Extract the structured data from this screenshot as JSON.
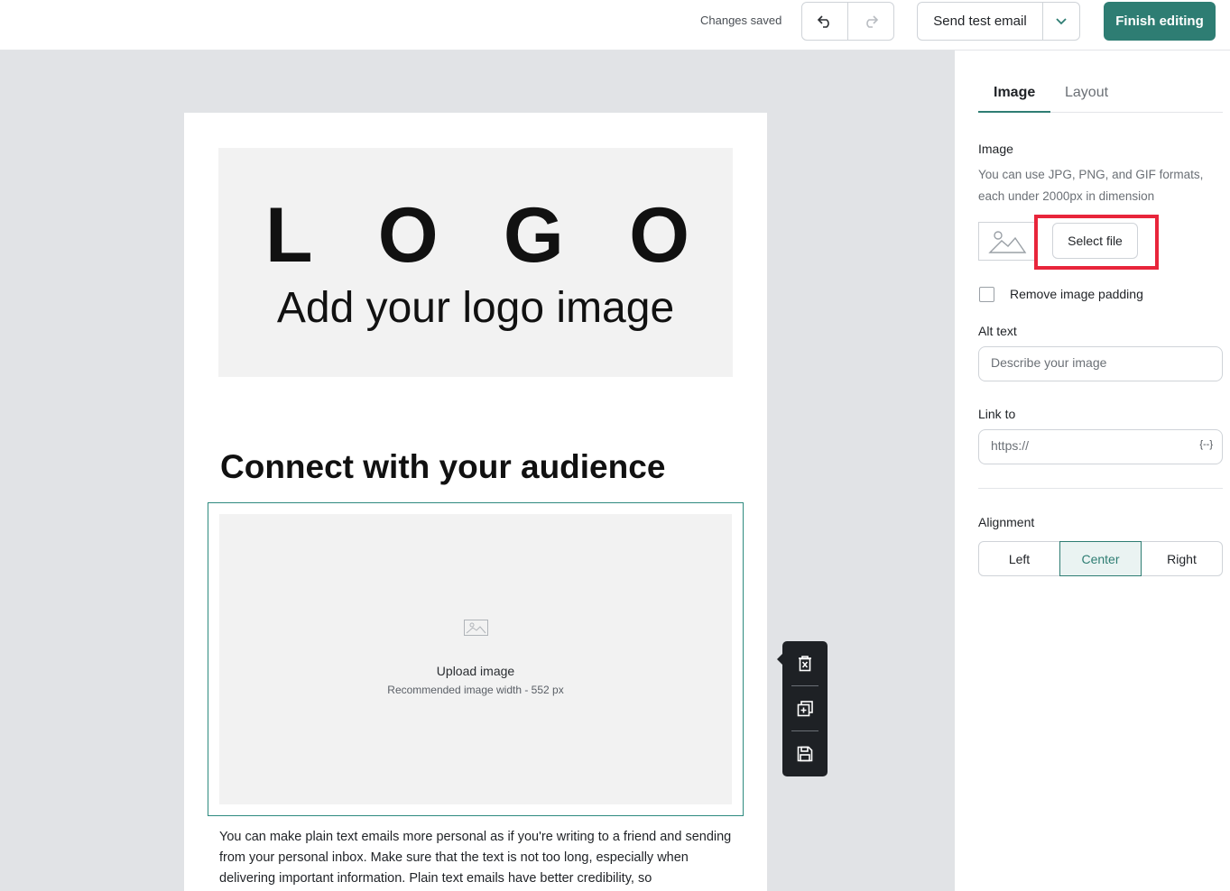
{
  "topbar": {
    "status": "Changes saved",
    "send_test_label": "Send test email",
    "finish_label": "Finish editing"
  },
  "email": {
    "logo_letters": [
      "L",
      "O",
      "G",
      "O"
    ],
    "logo_subtitle": "Add your logo image",
    "headline": "Connect with your audience",
    "upload_title": "Upload image",
    "upload_hint": "Recommended image width - 552 px",
    "body_text": "You can make plain text emails more personal as if you're writing to a friend and sending from your personal inbox. Make sure that the text is not too long, especially when delivering important information. Plain text emails have better credibility, so"
  },
  "panel": {
    "tabs": [
      {
        "label": "Image",
        "active": true
      },
      {
        "label": "Layout",
        "active": false
      }
    ],
    "image_label": "Image",
    "image_hint": "You can use JPG, PNG, and GIF formats, each under 2000px in dimension",
    "select_file_label": "Select file",
    "remove_padding_label": "Remove image padding",
    "alt_text_label": "Alt text",
    "alt_text_placeholder": "Describe your image",
    "link_label": "Link to",
    "link_placeholder": "https://",
    "var_icon_text": "{--}",
    "alignment_label": "Alignment",
    "alignment_options": [
      "Left",
      "Center",
      "Right"
    ],
    "alignment_selected": "Center"
  },
  "colors": {
    "accent": "#2e7d73",
    "highlight": "#e8253b",
    "canvas_bg": "#e1e3e6"
  }
}
